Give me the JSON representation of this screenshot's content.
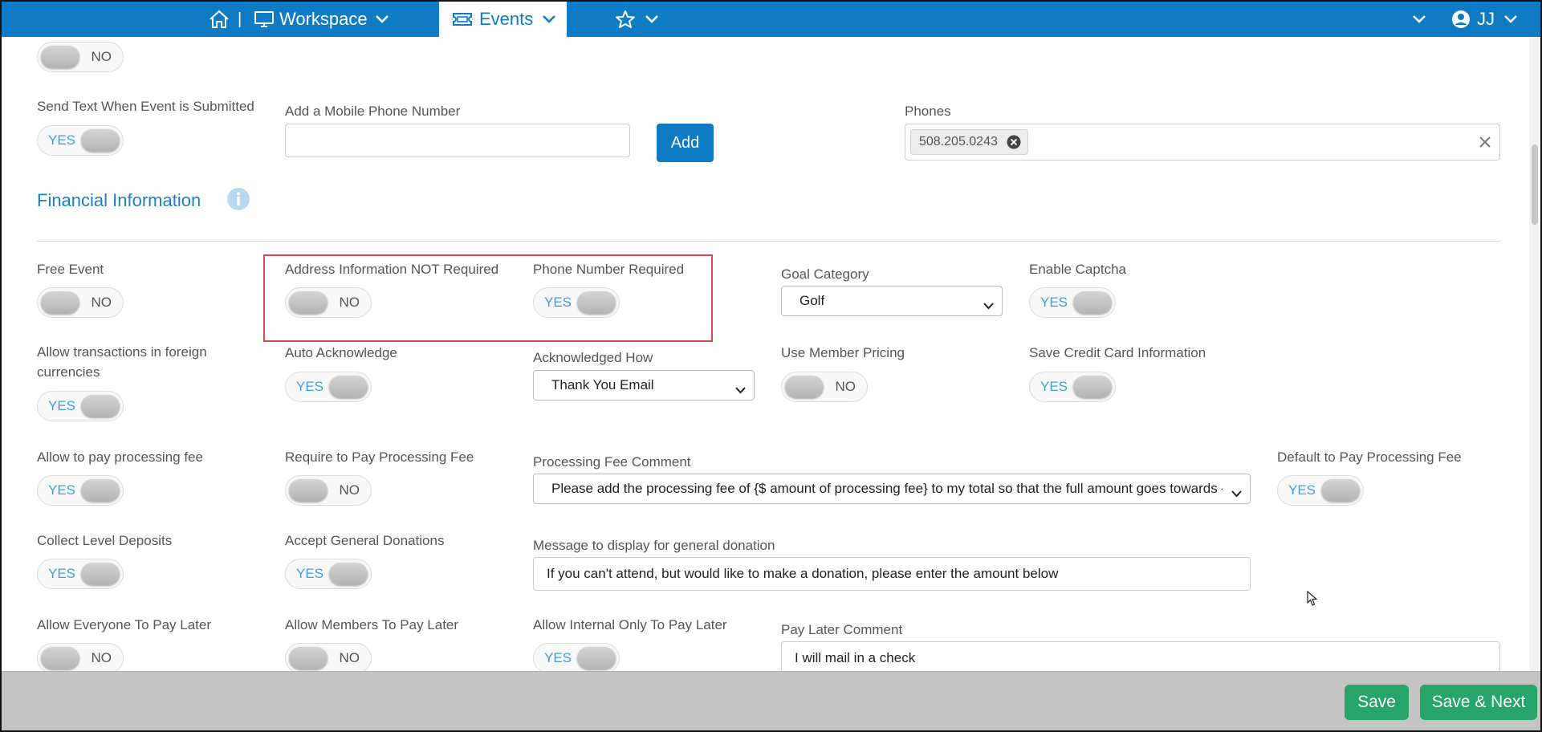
{
  "nav": {
    "workspace_label": "Workspace",
    "separator": "|",
    "events_label": "Events",
    "user_initials": "JJ",
    "icons": [
      "home-icon",
      "monitor-icon",
      "ticket-icon",
      "star-icon",
      "chevron-down-icon",
      "user-circle-icon"
    ]
  },
  "top_toggle": {
    "state": "NO"
  },
  "sms": {
    "send_text_label": "Send Text When Event is Submitted",
    "send_text_state": "YES",
    "mobile_label": "Add a Mobile Phone Number",
    "mobile_value": "",
    "add_button": "Add",
    "phones_label": "Phones",
    "phones": [
      "508.205.0243"
    ]
  },
  "financial": {
    "title": "Financial Information",
    "info_icon": "info-icon",
    "free_event": {
      "label": "Free Event",
      "state": "NO"
    },
    "address_not_required": {
      "label": "Address Information NOT Required",
      "state": "NO"
    },
    "phone_required": {
      "label": "Phone Number Required",
      "state": "YES"
    },
    "goal_category": {
      "label": "Goal Category",
      "value": "Golf"
    },
    "enable_captcha": {
      "label": "Enable Captcha",
      "state": "YES"
    },
    "foreign_currencies": {
      "label": "Allow transactions in foreign currencies",
      "state": "YES"
    },
    "auto_acknowledge": {
      "label": "Auto Acknowledge",
      "state": "YES"
    },
    "acknowledged_how": {
      "label": "Acknowledged How",
      "value": "Thank You Email"
    },
    "member_pricing": {
      "label": "Use Member Pricing",
      "state": "NO"
    },
    "save_credit_card": {
      "label": "Save Credit Card Information",
      "state": "YES"
    },
    "allow_processing_fee": {
      "label": "Allow to pay processing fee",
      "state": "YES"
    },
    "require_processing_fee": {
      "label": "Require to Pay Processing Fee",
      "state": "NO"
    },
    "processing_fee_comment": {
      "label": "Processing Fee Comment",
      "value": "Please add the processing fee of {$ amount of processing fee} to my total so that the full amount goes towards {Yo"
    },
    "default_processing_fee": {
      "label": "Default to Pay Processing Fee",
      "state": "YES"
    },
    "collect_level_deposits": {
      "label": "Collect Level Deposits",
      "state": "YES"
    },
    "accept_general_donations": {
      "label": "Accept General Donations",
      "state": "YES"
    },
    "general_donation_message": {
      "label": "Message to display for general donation",
      "value": "If you can't attend, but would like to make a donation, please enter the amount below"
    },
    "everyone_pay_later": {
      "label": "Allow Everyone To Pay Later",
      "state": "NO"
    },
    "members_pay_later": {
      "label": "Allow Members To Pay Later",
      "state": "NO"
    },
    "internal_pay_later": {
      "label": "Allow Internal Only To Pay Later",
      "state": "YES"
    },
    "pay_later_comment": {
      "label": "Pay Later Comment",
      "value": "I will mail in a check"
    }
  },
  "footer": {
    "save_label": "Save",
    "save_next_label": "Save & Next"
  },
  "colors": {
    "brand_blue": "#0e7bc4",
    "save_green": "#26a46a",
    "highlight_red": "#e0474c"
  }
}
